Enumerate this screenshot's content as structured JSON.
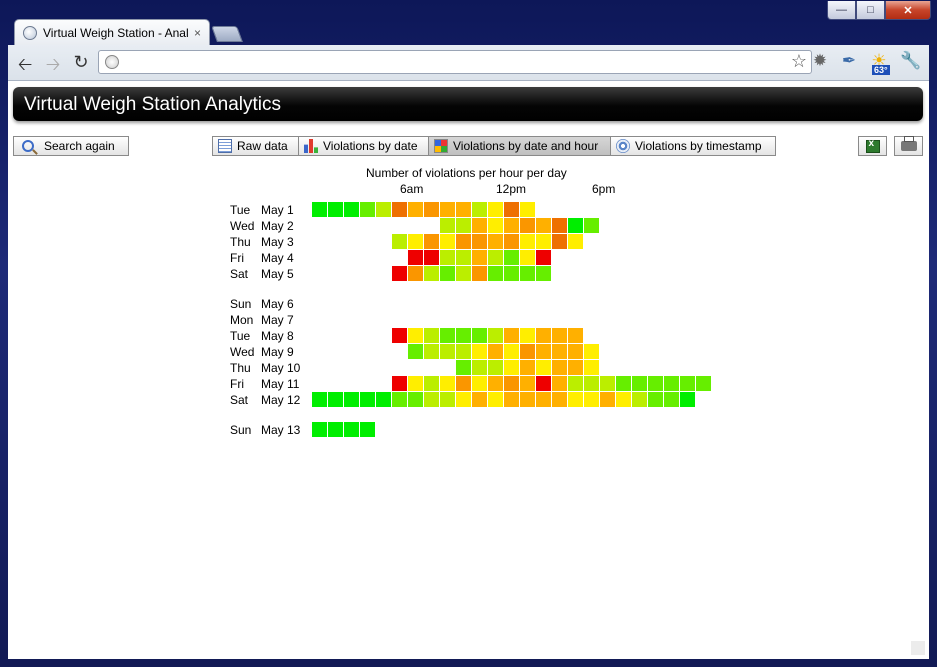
{
  "browser": {
    "tab_title": "Virtual Weigh Station - Anal",
    "tab_close": "×",
    "back_icon": "back-arrow-icon",
    "forward_icon": "forward-arrow-icon",
    "reload_icon": "reload-icon",
    "weather_temp": "63°",
    "window_controls": [
      "minimize-icon",
      "maximize-icon",
      "close-icon"
    ]
  },
  "app": {
    "title": "Virtual Weigh Station Analytics"
  },
  "toolbar": {
    "search_again": "Search again",
    "raw_data": "Raw data",
    "violations_by_date": "Violations by date",
    "violations_by_date_and_hour": "Violations by date and hour",
    "violations_by_timestamp": "Violations by timestamp",
    "active_tab": "violations_by_date_and_hour"
  },
  "chart_data": {
    "type": "heatmap",
    "title": "Number of violations per hour per day",
    "x_ticks": [
      {
        "label": "6am",
        "hour": 6
      },
      {
        "label": "12pm",
        "hour": 12
      },
      {
        "label": "6pm",
        "hour": 18
      }
    ],
    "x_range_hours": [
      0,
      23
    ],
    "color_scale": {
      "low": "#00ee00",
      "mid": "#ffee00",
      "high": "#ee0000"
    },
    "rows": [
      {
        "dow": "Tue",
        "date": "May 1",
        "start_hour": 0,
        "values": [
          0,
          0,
          0,
          1,
          2,
          6,
          4,
          5,
          4,
          4,
          2,
          3,
          6,
          3
        ]
      },
      {
        "dow": "Wed",
        "date": "May 2",
        "start_hour": 8,
        "values": [
          2,
          2,
          4,
          3,
          4,
          5,
          4,
          6,
          0,
          1
        ]
      },
      {
        "dow": "Thu",
        "date": "May 3",
        "start_hour": 5,
        "values": [
          2,
          3,
          5,
          3,
          5,
          5,
          4,
          5,
          3,
          3,
          6,
          3
        ]
      },
      {
        "dow": "Fri",
        "date": "May 4",
        "start_hour": 6,
        "values": [
          9,
          9,
          2,
          2,
          4,
          2,
          1,
          3,
          9
        ]
      },
      {
        "dow": "Sat",
        "date": "May 5",
        "start_hour": 5,
        "values": [
          9,
          5,
          2,
          1,
          2,
          5,
          1,
          1,
          1,
          1
        ]
      },
      {
        "gap": true
      },
      {
        "dow": "Sun",
        "date": "May 6",
        "start_hour": 0,
        "values": []
      },
      {
        "dow": "Mon",
        "date": "May 7",
        "start_hour": 0,
        "values": []
      },
      {
        "dow": "Tue",
        "date": "May 8",
        "start_hour": 5,
        "values": [
          9,
          3,
          2,
          1,
          1,
          1,
          2,
          4,
          3,
          4,
          4,
          4
        ]
      },
      {
        "dow": "Wed",
        "date": "May 9",
        "start_hour": 6,
        "values": [
          1,
          2,
          2,
          2,
          3,
          4,
          3,
          5,
          4,
          4,
          4,
          3
        ]
      },
      {
        "dow": "Thu",
        "date": "May 10",
        "start_hour": 9,
        "values": [
          1,
          2,
          2,
          3,
          4,
          3,
          4,
          4,
          3
        ]
      },
      {
        "dow": "Fri",
        "date": "May 11",
        "start_hour": 5,
        "values": [
          9,
          3,
          2,
          3,
          5,
          3,
          4,
          5,
          4,
          9,
          4,
          2,
          2,
          2,
          1,
          1,
          1,
          1,
          1,
          1
        ]
      },
      {
        "dow": "Sat",
        "date": "May 12",
        "start_hour": 0,
        "values": [
          0,
          0,
          0,
          0,
          0,
          1,
          1,
          2,
          2,
          3,
          4,
          3,
          4,
          4,
          4,
          4,
          3,
          3,
          4,
          3,
          2,
          1,
          1,
          0
        ]
      },
      {
        "gap": true
      },
      {
        "dow": "Sun",
        "date": "May 13",
        "start_hour": 0,
        "values": [
          0,
          0,
          0,
          0
        ]
      }
    ]
  }
}
